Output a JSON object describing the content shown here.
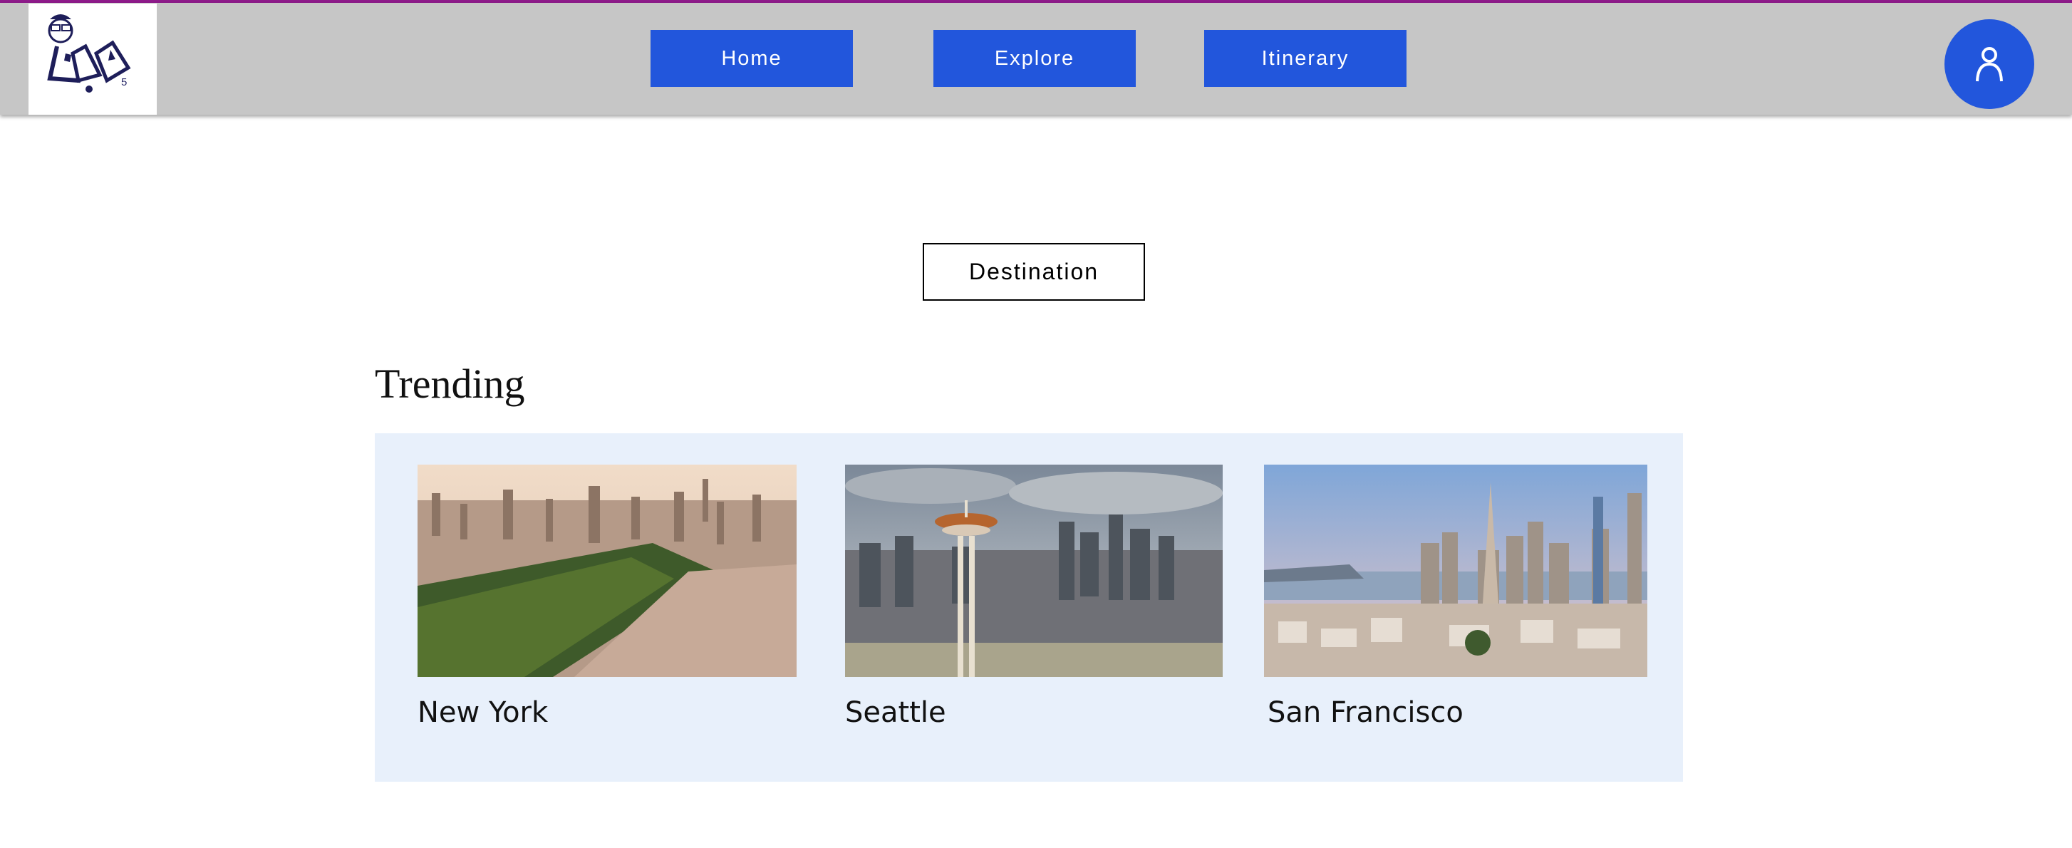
{
  "header": {
    "logo_text": "5",
    "nav": [
      {
        "label": "Home"
      },
      {
        "label": "Explore"
      },
      {
        "label": "Itinerary"
      }
    ],
    "profile_icon": "user-icon"
  },
  "main": {
    "destination_button": "Destination",
    "section_title": "Trending",
    "cards": [
      {
        "city": "New York"
      },
      {
        "city": "Seattle"
      },
      {
        "city": "San Francisco"
      }
    ]
  },
  "colors": {
    "accent": "#2256dc",
    "header_bg": "#c6c6c6",
    "top_line": "#8e1b8a",
    "panel_bg": "#e8f0fb"
  }
}
